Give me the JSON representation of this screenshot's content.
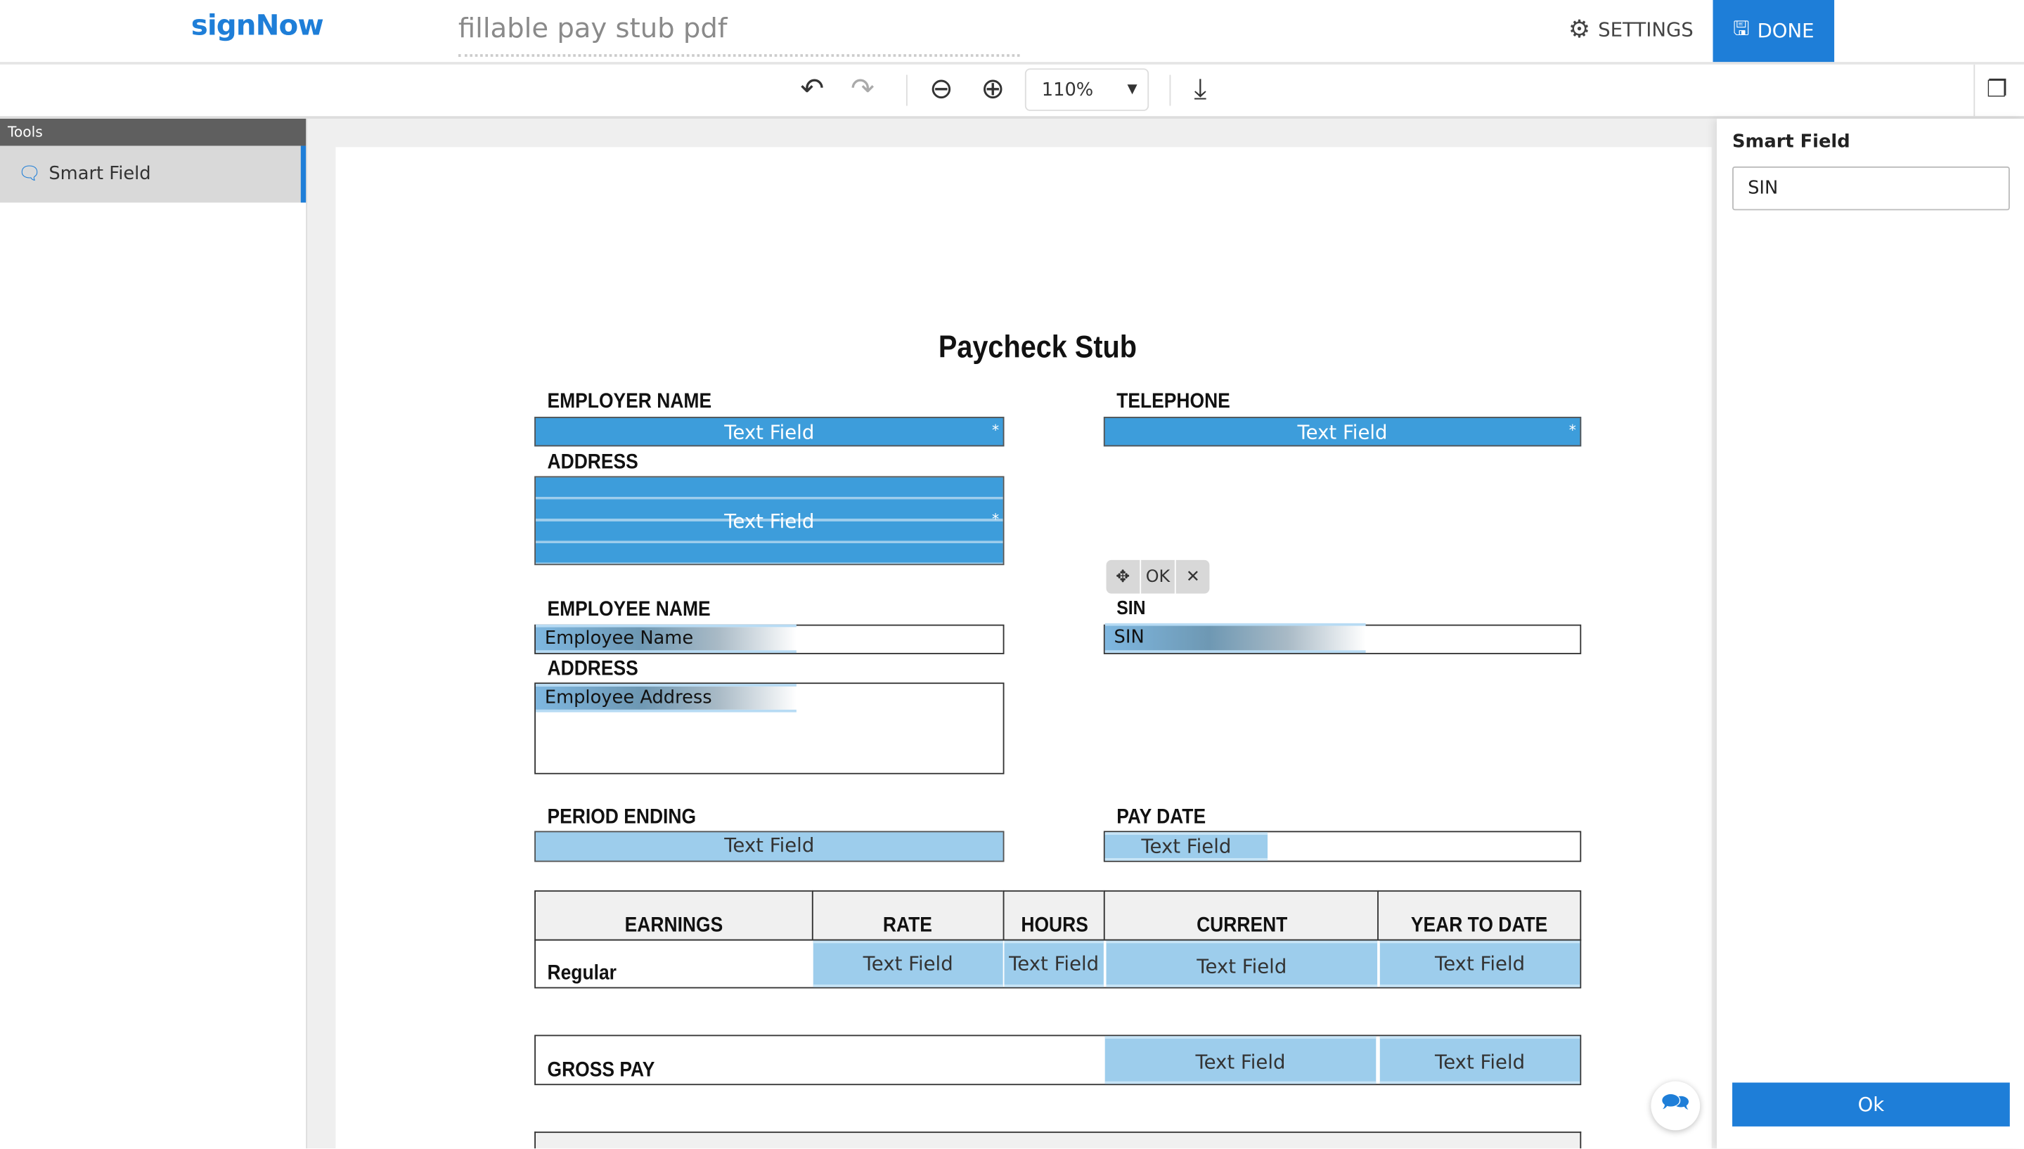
{
  "header": {
    "logo": "signNow",
    "document_title": "fillable pay stub pdf",
    "settings_label": "SETTINGS",
    "done_label": "DONE"
  },
  "toolbar": {
    "zoom_value": "110%"
  },
  "sidebar": {
    "section_title": "Tools",
    "items": [
      {
        "label": "Smart Field",
        "icon": "chat-bubble-icon"
      }
    ]
  },
  "right_panel": {
    "title": "Smart Field",
    "input_value": "SIN",
    "ok_label": "Ok"
  },
  "field_popup": {
    "ok_label": "OK"
  },
  "document": {
    "title": "Paycheck Stub",
    "employer_name_label": "EMPLOYER NAME",
    "telephone_label": "TELEPHONE",
    "address_label": "ADDRESS",
    "employee_name_label": "EMPLOYEE NAME",
    "employee_address_label": "ADDRESS",
    "sin_label": "SIN",
    "period_ending_label": "PERIOD ENDING",
    "pay_date_label": "PAY DATE",
    "text_field": "Text Field",
    "required_mark": "*",
    "employee_name_field": "Employee Name",
    "employee_address_field": "Employee Address",
    "sin_field": "SIN",
    "table_headers": [
      "EARNINGS",
      "RATE",
      "HOURS",
      "CURRENT",
      "YEAR TO DATE"
    ],
    "regular_label": "Regular",
    "gross_pay_label": "GROSS PAY"
  },
  "colors": {
    "accent": "#1e7ed8",
    "field_required": "#3d9ddb",
    "field_optional": "#9dcdec"
  }
}
